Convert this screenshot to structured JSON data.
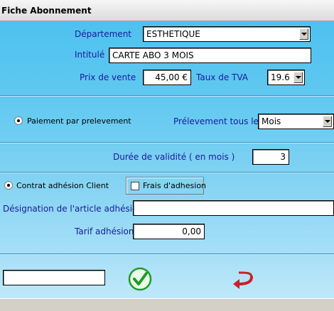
{
  "window": {
    "title": "Fiche Abonnement"
  },
  "form": {
    "departement": {
      "label": "Département",
      "value": "ESTHETIQUE"
    },
    "intitule": {
      "label": "Intitulé",
      "value": "CARTE ABO 3 MOIS"
    },
    "prix": {
      "label": "Prix de vente",
      "value": "45,00 €"
    },
    "tva": {
      "label": "Taux de TVA",
      "value": "19.6"
    },
    "paiement": {
      "label": "Paiement par prelevement",
      "selected": true
    },
    "prelevement": {
      "label": "Prélevement tous les",
      "value": "Mois"
    },
    "duree": {
      "label": "Durée de validité ( en mois )",
      "value": "3"
    },
    "contrat": {
      "label": "Contrat adhésion Client",
      "selected": true
    },
    "frais": {
      "label": "Frais d'adhesion",
      "checked": false
    },
    "designation": {
      "label": "Désignation de l'article adhésion",
      "value": ""
    },
    "tarif": {
      "label": "Tarif adhésion",
      "value": "0,00"
    },
    "bottom_field": {
      "value": ""
    }
  },
  "icons": {
    "validate": "check-circle-icon",
    "back": "return-arrow-icon"
  },
  "colors": {
    "panel_top": "#4ec1ef",
    "panel_bottom": "#bfe8fa",
    "label_blue": "#1a1a9c",
    "validate_green": "#1f9a2a",
    "back_red": "#c8202a"
  }
}
